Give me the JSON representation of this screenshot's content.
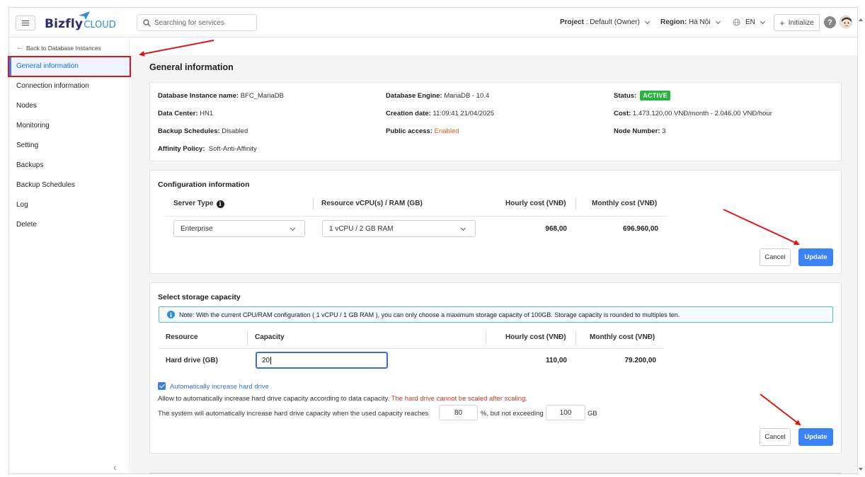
{
  "header": {
    "logo_main": "Bizfly",
    "logo_sub": "CLOUD",
    "search_placeholder": "Searching for services",
    "project_label": "Project",
    "project_value": ": Default (Owner)",
    "region_label": "Region:",
    "region_value": "Hà Nội",
    "language": "EN",
    "initialize_label": "Initialize",
    "help_symbol": "?"
  },
  "sidebar": {
    "back_label": "Back to Database Instances",
    "items": [
      {
        "label": "General information"
      },
      {
        "label": "Connection information"
      },
      {
        "label": "Nodes"
      },
      {
        "label": "Monitoring"
      },
      {
        "label": "Setting"
      },
      {
        "label": "Backups"
      },
      {
        "label": "Backup Schedules"
      },
      {
        "label": "Log"
      },
      {
        "label": "Delete"
      }
    ],
    "collapse_icon": "‹"
  },
  "general": {
    "title": "General information",
    "instance_name_label": "Database Instance name:",
    "instance_name": "BFC_MariaDB",
    "engine_label": "Database Engine:",
    "engine": "MariaDB - 10.4",
    "status_label": "Status:",
    "status": "ACTIVE",
    "datacenter_label": "Data Center:",
    "datacenter": "HN1",
    "creation_label": "Creation date:",
    "creation": "11:09:41 21/04/2025",
    "cost_label": "Cost:",
    "cost": "1.473.120,00 VNĐ/month - 2.046,00 VNĐ/hour",
    "backup_label": "Backup Schedules:",
    "backup": "Disabled",
    "public_label": "Public access:",
    "public": "Enabled",
    "nodes_label": "Node Number:",
    "nodes": "3",
    "affinity_label": "Affinity Policy:",
    "affinity": "Soft-Anti-Affinity"
  },
  "config": {
    "title": "Configuration information",
    "col_server_type": "Server Type",
    "col_resource": "Resource vCPU(s) / RAM (GB)",
    "col_hourly": "Hourly cost (VNĐ)",
    "col_monthly": "Monthly cost (VNĐ)",
    "server_type": "Enterprise",
    "resource": "1 vCPU / 2 GB RAM",
    "hourly": "968,00",
    "monthly": "696.960,00",
    "cancel": "Cancel",
    "update": "Update"
  },
  "storage": {
    "title": "Select storage capacity",
    "note": "Note: With the current CPU/RAM configuration ( 1 vCPU / 1 GB RAM ), you can only choose a maximum storage capacity of 100GB. Storage capacity is rounded to multiples ten.",
    "col_resource": "Resource",
    "col_capacity": "Capacity",
    "col_hourly": "Hourly cost (VNĐ)",
    "col_monthly": "Monthly cost (VNĐ)",
    "row_label": "Hard drive (GB)",
    "capacity_value": "20",
    "hourly": "110,00",
    "monthly": "79.200,00",
    "auto_label": "Automatically increase hard drive",
    "auto_desc": "Allow to automatically increase hard drive capacity according to data capacity.",
    "auto_warn": "The hard drive cannot be scaled after scaling.",
    "threshold_prefix": "The system will automatically increase hard drive capacity when the used capacity reaches",
    "threshold_value": "80",
    "threshold_mid": "%, but not exceeding",
    "max_value": "100",
    "max_unit": "GB",
    "cancel": "Cancel",
    "update": "Update"
  },
  "colors": {
    "accent": "#3b82f6",
    "active": "#27b53f",
    "annotation": "#e01414"
  }
}
